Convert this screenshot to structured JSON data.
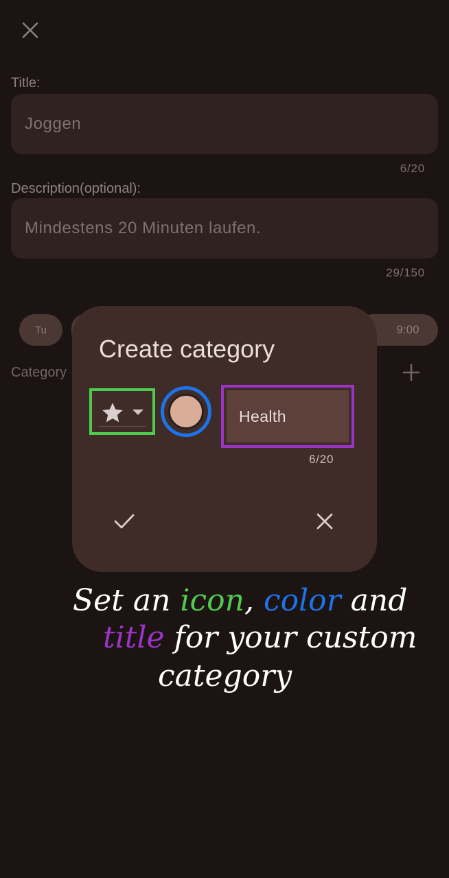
{
  "form": {
    "title_label": "Title:",
    "title_value": "Joggen",
    "title_counter": "6/20",
    "description_label": "Description(optional):",
    "description_value": "Mindestens 20 Minuten laufen.",
    "description_counter": "29/150",
    "day_chip": "Tu",
    "time_chip": "9:00",
    "category_label": "Category"
  },
  "dialog": {
    "title": "Create category",
    "selected_icon": "star-icon",
    "selected_color": "#d9ad98",
    "name_value": "Health",
    "name_counter": "6/20"
  },
  "annotation": {
    "lines": [
      "Set an icon, color and",
      "title for your custom",
      "category"
    ],
    "words": {
      "icon": "icon",
      "color": "color",
      "title": "title"
    },
    "colors": {
      "icon": "#4ecb4e",
      "color": "#1d73e8",
      "title": "#9a34c4",
      "text": "#ffffff"
    }
  }
}
